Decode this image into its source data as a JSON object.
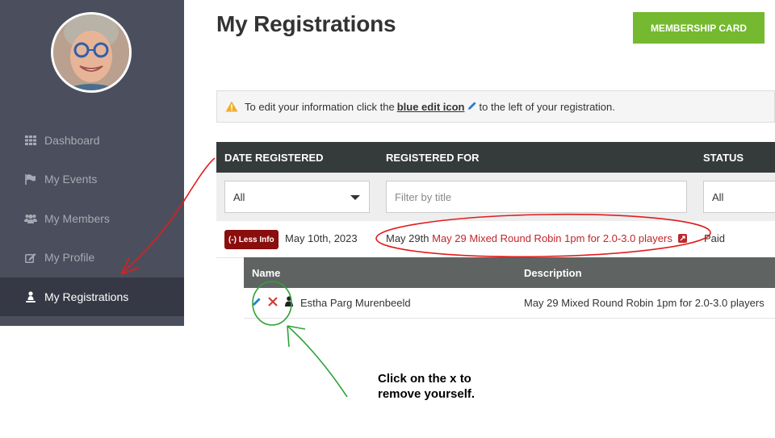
{
  "sidebar": {
    "avatar_alt": "",
    "items": [
      {
        "label": "Dashboard",
        "icon": "grid-icon"
      },
      {
        "label": "My Events",
        "icon": "flag-icon"
      },
      {
        "label": "My Members",
        "icon": "users-icon"
      },
      {
        "label": "My Profile",
        "icon": "edit-square-icon"
      },
      {
        "label": "My Registrations",
        "icon": "user-download-icon",
        "active": true
      }
    ]
  },
  "header": {
    "title": "My Registrations",
    "membership_button": "MEMBERSHIP CARD"
  },
  "notice": {
    "prefix": "To edit your information click the",
    "link_text": "blue edit icon",
    "suffix": "to the left of your registration."
  },
  "table": {
    "columns": [
      "DATE REGISTERED",
      "REGISTERED FOR",
      "STATUS"
    ],
    "filters": {
      "date_select": "All",
      "title_placeholder": "Filter by title",
      "status_select": "All"
    },
    "row": {
      "less_info": "(-) Less Info",
      "date": "May 10th, 2023",
      "event_date": "May 29th",
      "event_title": "May 29 Mixed Round Robin 1pm for 2.0-3.0 players",
      "status": "Paid"
    },
    "sub_table": {
      "columns": [
        "Name",
        "Description"
      ],
      "rows": [
        {
          "name": "Estha Parg Murenbeeld",
          "description": "May 29 Mixed Round Robin 1pm for 2.0-3.0 players"
        }
      ]
    }
  },
  "annotation": {
    "line1": "Click on the x to",
    "line2": "remove yourself."
  },
  "colors": {
    "sidebar_bg": "#4b4f5d",
    "active_bg": "#363945",
    "accent_green": "#74b92f",
    "event_red": "#c0262b",
    "less_info_red": "#8b0e0e",
    "header_dark": "#353b3b"
  }
}
